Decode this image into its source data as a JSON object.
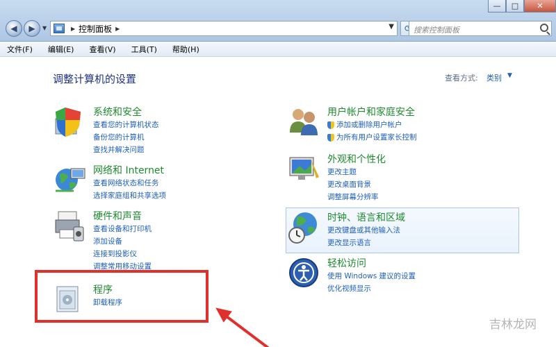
{
  "window": {
    "minimize": "—",
    "maximize": "□",
    "close": "✕"
  },
  "address": {
    "path": "控制面板",
    "search_placeholder": "搜索控制面板"
  },
  "menu": [
    "文件(F)",
    "编辑(E)",
    "查看(V)",
    "工具(T)",
    "帮助(H)"
  ],
  "page": {
    "title": "调整计算机的设置",
    "view_by_label": "查看方式:",
    "view_by_value": "类别"
  },
  "categories": [
    {
      "title": "系统和安全",
      "links": [
        "查看您的计算机状态",
        "备份您的计算机",
        "查找并解决问题"
      ]
    },
    {
      "title": "网络和 Internet",
      "links": [
        "查看网络状态和任务",
        "选择家庭组和共享选项"
      ]
    },
    {
      "title": "硬件和声音",
      "links": [
        "查看设备和打印机",
        "添加设备",
        "连接到投影仪",
        "调整常用移动设置"
      ]
    },
    {
      "title": "程序",
      "links": [
        "卸载程序"
      ]
    },
    {
      "title": "用户帐户和家庭安全",
      "links": [
        "添加或删除用户帐户",
        "为所有用户设置家长控制"
      ]
    },
    {
      "title": "外观和个性化",
      "links": [
        "更改主题",
        "更改桌面背景",
        "调整屏幕分辨率"
      ]
    },
    {
      "title": "时钟、语言和区域",
      "links": [
        "更改键盘或其他输入法",
        "更改显示语言"
      ]
    },
    {
      "title": "轻松访问",
      "links": [
        "使用 Windows 建议的设置",
        "优化视频显示"
      ]
    }
  ],
  "watermark": "吉林龙网",
  "colors": {
    "category_title": "#1e8a2f",
    "link": "#1e5ebc",
    "highlight": "#e0302b"
  }
}
